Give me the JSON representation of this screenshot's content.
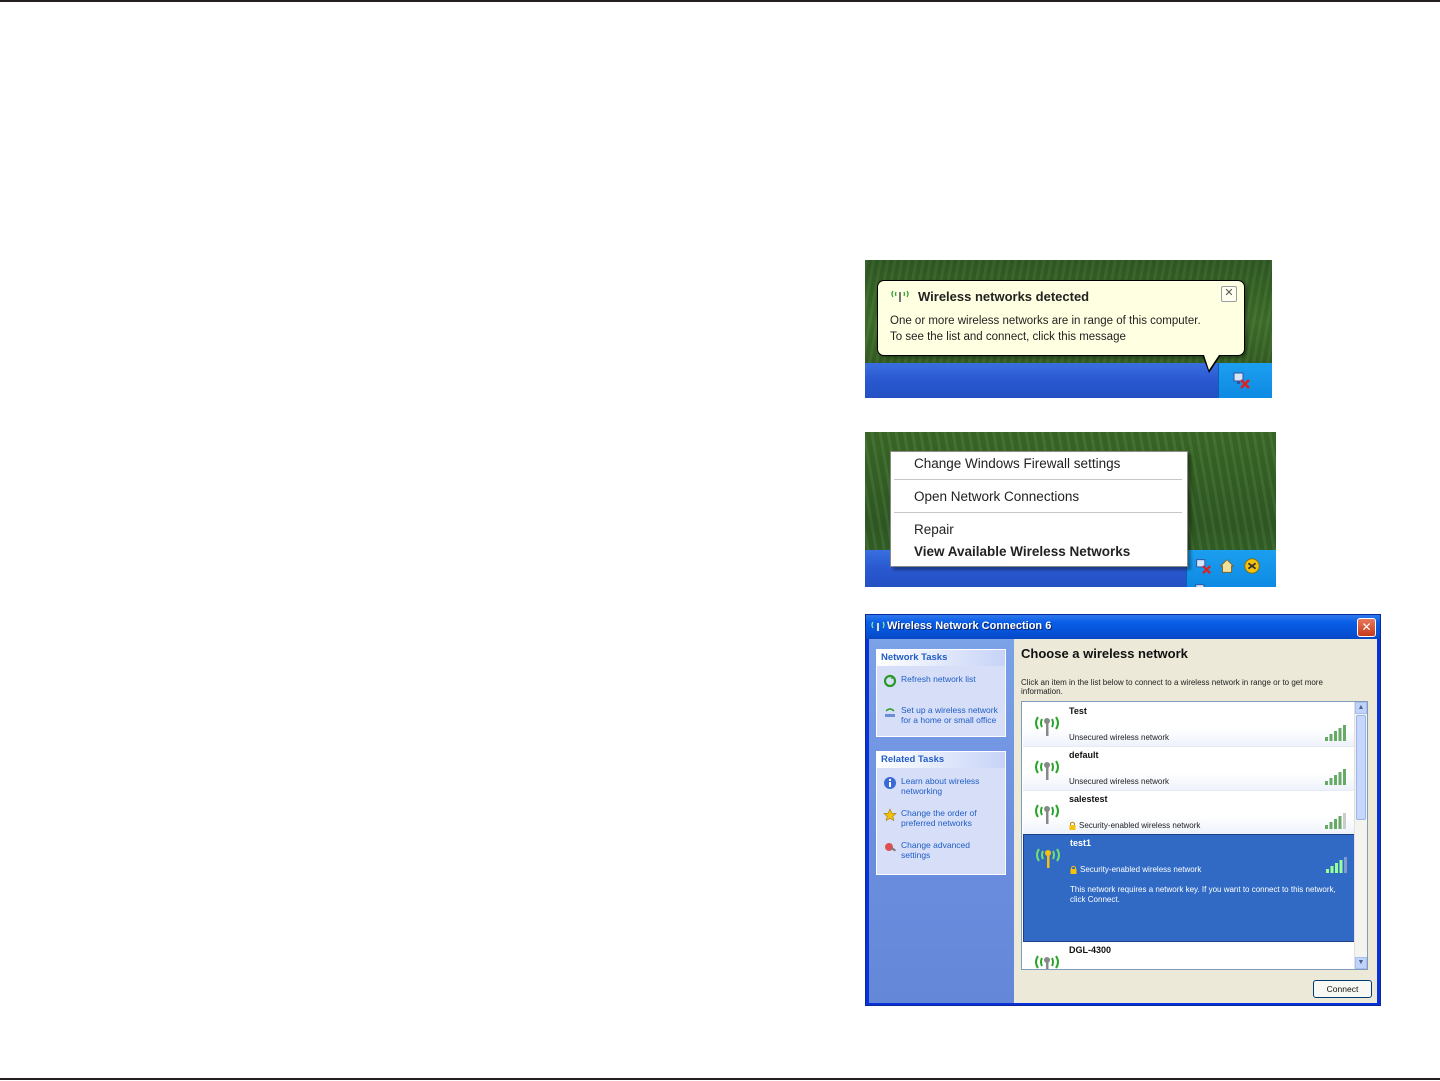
{
  "balloon": {
    "title": "Wireless networks detected",
    "close_label": "✕",
    "message_line1": "One or more wireless networks are in range of this computer.",
    "message_line2": "To see the list and connect, click this message"
  },
  "context_menu": {
    "items": [
      "Change Windows Firewall settings",
      "Open Network Connections",
      "Repair",
      "View Available Wireless Networks"
    ]
  },
  "dialog": {
    "title": "Wireless Network Connection 6",
    "close_label": "✕",
    "network_tasks": {
      "header": "Network Tasks",
      "links": [
        "Refresh network list",
        "Set up a wireless network for a home or small office"
      ]
    },
    "related_tasks": {
      "header": "Related Tasks",
      "links": [
        "Learn about wireless networking",
        "Change the order of preferred networks",
        "Change advanced settings"
      ]
    },
    "main_title": "Choose a wireless network",
    "instructions": "Click an item in the list below to connect to a wireless network in range or to get more information.",
    "networks": [
      {
        "name": "Test",
        "status": "Unsecured wireless network",
        "secured": false,
        "signal_bars": 5
      },
      {
        "name": "default",
        "status": "Unsecured wireless network",
        "secured": false,
        "signal_bars": 5
      },
      {
        "name": "salestest",
        "status": "Security-enabled wireless network",
        "secured": true,
        "signal_bars": 4
      },
      {
        "name": "test1",
        "status": "Security-enabled wireless network",
        "secured": true,
        "signal_bars": 4,
        "selected": true,
        "description": "This network requires a network key. If you want to connect to this network, click Connect."
      },
      {
        "name": "DGL-4300",
        "status": "",
        "secured": false,
        "signal_bars": 5
      }
    ],
    "connect_label": "Connect"
  },
  "colors": {
    "xp_blue": "#0831d9",
    "balloon_bg": "#ffffe1",
    "selection": "#316ac5",
    "task_link": "#215dc6"
  }
}
